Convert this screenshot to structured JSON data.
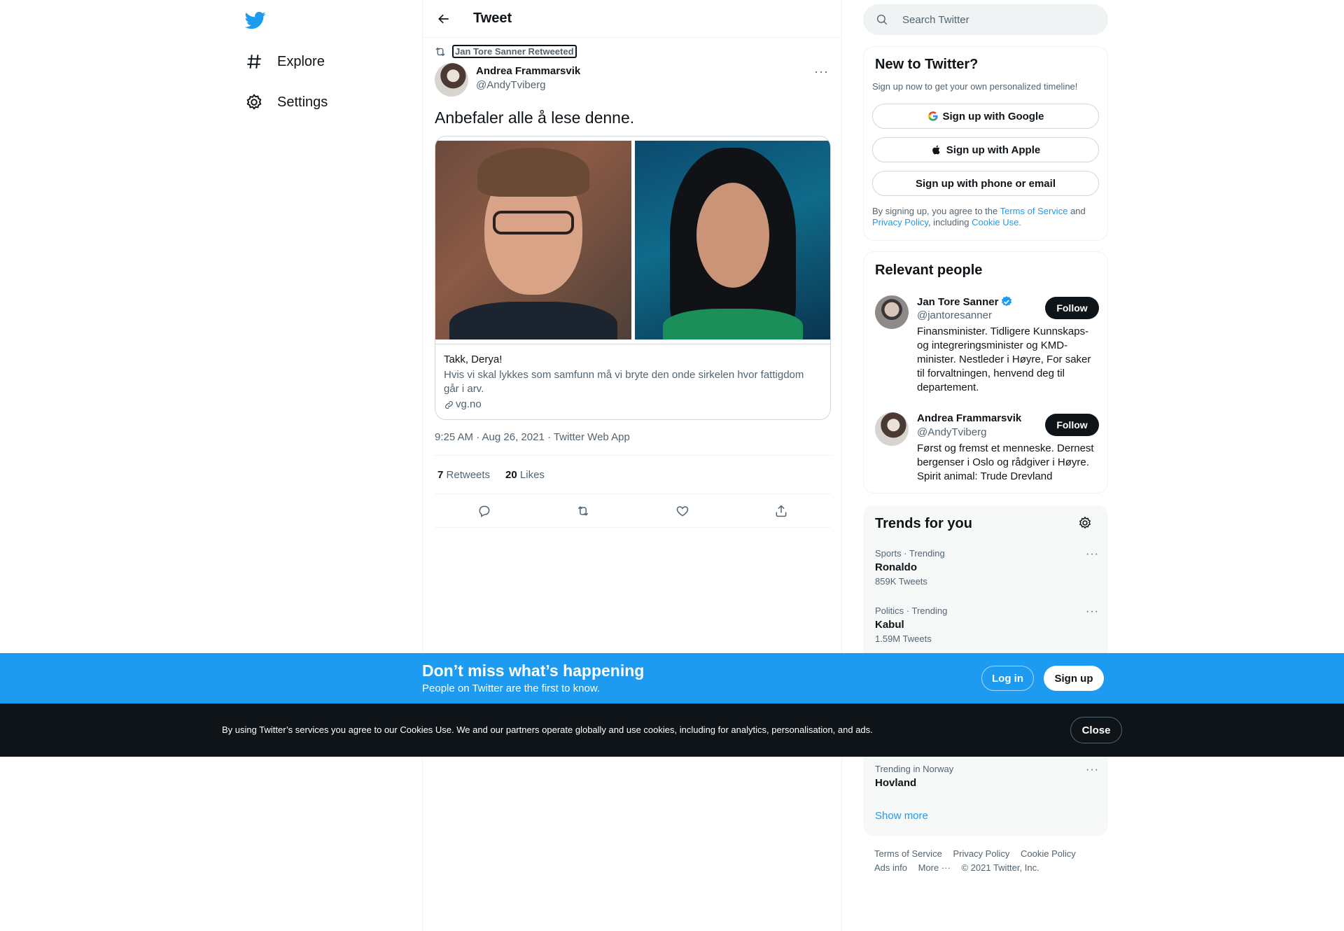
{
  "nav": {
    "explore_label": "Explore",
    "settings_label": "Settings"
  },
  "header": {
    "title": "Tweet"
  },
  "tweet": {
    "retweeted_by": "Jan Tore Sanner Retweeted",
    "author_name": "Andrea Frammarsvik",
    "author_handle": "@AndyTviberg",
    "more": "···",
    "text": "Anbefaler alle å lese denne.",
    "card": {
      "title": "Takk, Derya!",
      "description": "Hvis vi skal lykkes som samfunn må vi bryte den onde sirkelen hvor fattigdom går i arv.",
      "domain": "vg.no"
    },
    "timestamp": "9:25 AM · Aug 26, 2021 · Twitter Web App",
    "retweets_count": "7",
    "retweets_label": "Retweets",
    "likes_count": "20",
    "likes_label": "Likes"
  },
  "search": {
    "placeholder": "Search Twitter"
  },
  "new_to_twitter": {
    "title": "New to Twitter?",
    "subtitle": "Sign up now to get your own personalized timeline!",
    "google_label": "Sign up with Google",
    "apple_label": "Sign up with Apple",
    "phone_label": "Sign up with phone or email",
    "terms_prefix": "By signing up, you agree to the",
    "terms_link": "Terms of Service",
    "terms_and": "and",
    "privacy_link": "Privacy Policy",
    "terms_including": ", including",
    "cookie_link": "Cookie Use."
  },
  "relevant_people": {
    "title": "Relevant people",
    "people": [
      {
        "name": "Jan Tore Sanner",
        "handle": "@jantoresanner",
        "bio": "Finansminister. Tidligere Kunnskaps- og integreringsminister og KMD-minister. Nestleder i Høyre, For saker til forvaltningen, henvend deg til departement.",
        "follow_label": "Follow"
      },
      {
        "name": "Andrea Frammarsvik",
        "handle": "@AndyTviberg",
        "bio": "Først og fremst et menneske. Dernest bergenser i Oslo og rådgiver i Høyre. Spirit animal: Trude Drevland",
        "follow_label": "Follow"
      }
    ]
  },
  "trends": {
    "title": "Trends for you",
    "items": [
      {
        "context": "Sports · Trending",
        "name": "Ronaldo",
        "count": "859K Tweets"
      },
      {
        "context": "Politics · Trending",
        "name": "Kabul",
        "count": "1.59M Tweets"
      },
      {
        "context": "Trending in Norway",
        "name": "Hovland",
        "count": ""
      }
    ],
    "more_dots": "···",
    "show_more": "Show more"
  },
  "footer": {
    "links": [
      "Terms of Service",
      "Privacy Policy",
      "Cookie Policy",
      "Ads info",
      "More ···"
    ],
    "copyright": "© 2021 Twitter, Inc."
  },
  "banner": {
    "title": "Don’t miss what’s happening",
    "subtitle": "People on Twitter are the first to know.",
    "login_label": "Log in",
    "signup_label": "Sign up"
  },
  "cookie": {
    "text": "By using Twitter’s services you agree to our Cookies Use. We and our partners operate globally and use cookies, including for analytics, personalisation, and ads.",
    "close_label": "Close"
  },
  "colors": {
    "brand": "#1d9bf0",
    "text_primary": "#0f1419",
    "text_secondary": "#536471",
    "cookie_bar": "#0f1419"
  },
  "icons": {
    "logo": "twitter-bird-icon",
    "explore": "hashtag-icon",
    "settings": "gear-icon",
    "back": "arrow-left-icon",
    "retweet": "retweet-icon",
    "reply": "reply-icon",
    "like": "heart-icon",
    "share": "share-icon",
    "search": "search-icon",
    "verified": "verified-badge-icon",
    "link": "link-icon"
  }
}
